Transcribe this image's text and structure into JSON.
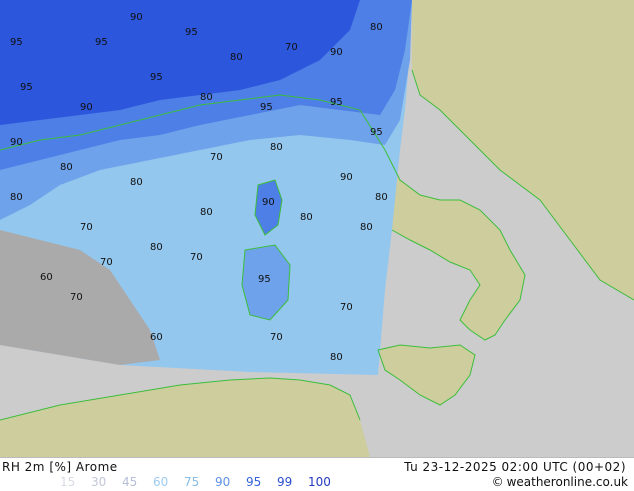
{
  "map": {
    "colors": {
      "sea_outside": "#cccccc",
      "land_outside": "#cdcd9d",
      "border": "#3cbe3c",
      "rh_60": "#8cc8f5",
      "rh_70": "#94c7ee",
      "rh_80": "#6ea2ea",
      "rh_90": "#4d7fe6",
      "rh_95": "#2c56dc",
      "rh_dry": "#aaaaaa"
    },
    "contour_labels": [
      "60",
      "70",
      "80",
      "90",
      "95"
    ]
  },
  "footer": {
    "title": "RH 2m [%] Arome",
    "valid_time": "Tu 23-12-2025 02:00 UTC (00+02)",
    "credit": "weatheronline.co.uk",
    "legend": [
      {
        "value": "15",
        "color": "#d8dbe4"
      },
      {
        "value": "30",
        "color": "#c3c7d8"
      },
      {
        "value": "45",
        "color": "#b6bdd6"
      },
      {
        "value": "60",
        "color": "#9ecbf2"
      },
      {
        "value": "75",
        "color": "#86bde8"
      },
      {
        "value": "90",
        "color": "#5e91e6"
      },
      {
        "value": "95",
        "color": "#3462da"
      },
      {
        "value": "99",
        "color": "#2a4ed0"
      },
      {
        "value": "100",
        "color": "#2438c4"
      }
    ]
  }
}
